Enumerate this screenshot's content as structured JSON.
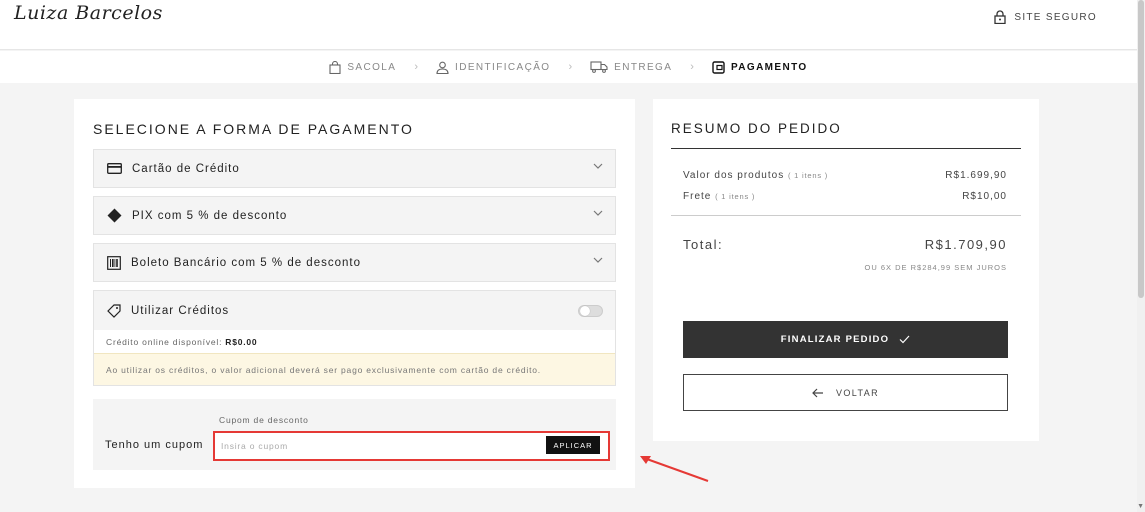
{
  "brand": {
    "logo_text": "Luiza Barcelos"
  },
  "header": {
    "secure_label": "SITE SEGURO"
  },
  "steps": [
    {
      "label": "SACOLA",
      "icon": "bag-icon"
    },
    {
      "label": "IDENTIFICAÇÃO",
      "icon": "user-icon"
    },
    {
      "label": "ENTREGA",
      "icon": "truck-icon"
    },
    {
      "label": "PAGAMENTO",
      "icon": "wallet-icon",
      "active": true
    }
  ],
  "payment": {
    "title": "SELECIONE A FORMA DE PAGAMENTO",
    "methods": [
      {
        "label": "Cartão de Crédito",
        "icon": "credit-card-icon"
      },
      {
        "label": "PIX com 5 % de desconto",
        "icon": "pix-icon"
      },
      {
        "label": "Boleto Bancário com 5 % de desconto",
        "icon": "barcode-icon"
      }
    ],
    "credits": {
      "label": "Utilizar Créditos",
      "icon": "tag-icon",
      "available_label": "Crédito online disponível:",
      "available_value": "R$0.00",
      "note": "Ao utilizar os créditos, o valor adicional deverá ser pago exclusivamente com cartão de crédito.",
      "toggle_on": false
    },
    "coupon": {
      "label": "Tenho um cupom",
      "caption": "Cupom de desconto",
      "placeholder": "Insira o cupom",
      "value": "",
      "apply_label": "APLICAR"
    }
  },
  "summary": {
    "title": "RESUMO DO PEDIDO",
    "products_label": "Valor dos produtos",
    "products_count": "( 1 itens )",
    "products_value": "R$1.699,90",
    "shipping_label": "Frete",
    "shipping_count": "( 1 itens )",
    "shipping_value": "R$10,00",
    "total_label": "Total:",
    "total_value": "R$1.709,90",
    "installments": "OU 6X DE R$284,99 SEM JUROS",
    "finalize_label": "FINALIZAR PEDIDO",
    "back_label": "VOLTAR"
  },
  "colors": {
    "highlight": "#e53935",
    "primary_button": "#333333",
    "note_bg": "#fdf7e3"
  }
}
